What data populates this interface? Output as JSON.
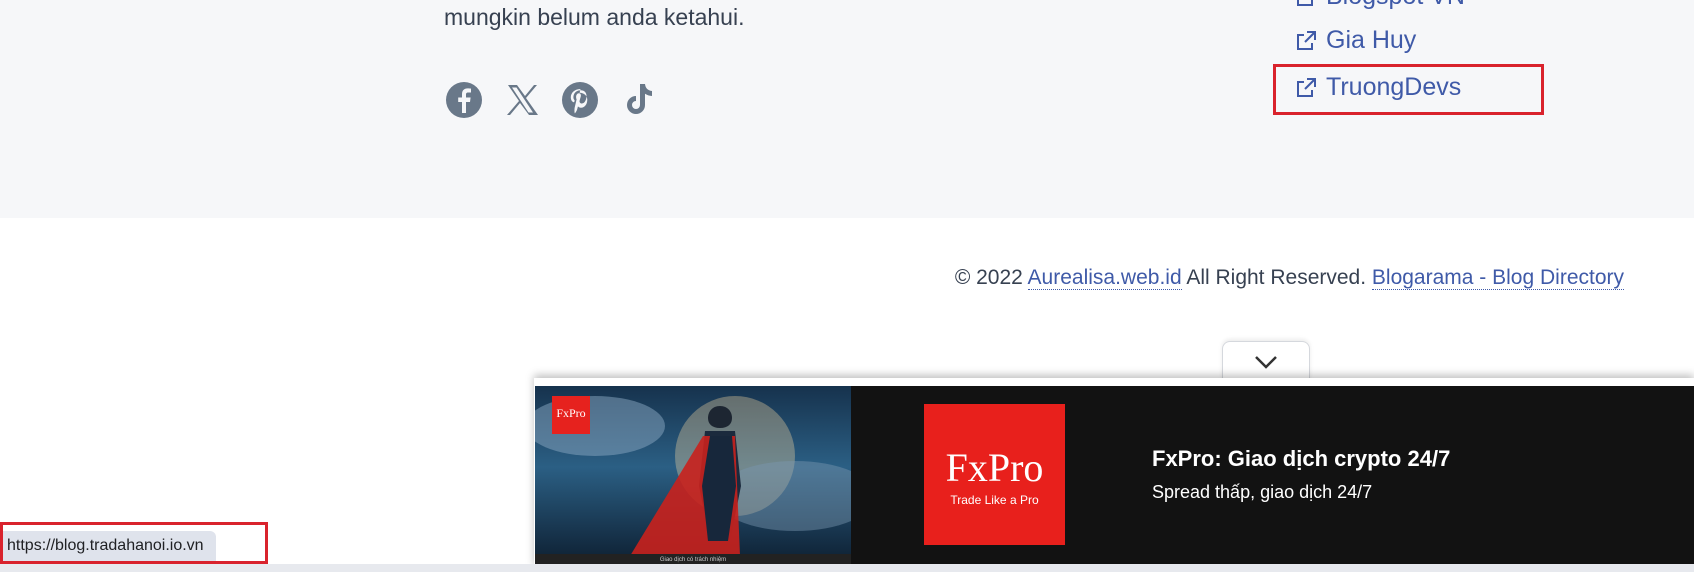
{
  "footer": {
    "about_text": "mungkin belum anda ketahui.",
    "social_icons": [
      "facebook-icon",
      "x-icon",
      "pinterest-icon",
      "tiktok-icon"
    ],
    "links": [
      {
        "label": "Blogspot VN",
        "icon": "external-link-icon"
      },
      {
        "label": "Gia Huy",
        "icon": "external-link-icon"
      },
      {
        "label": "TruongDevs",
        "icon": "external-link-icon",
        "highlighted": true
      }
    ],
    "copyright": {
      "prefix": "© 2022",
      "site_link": "Aurealisa.web.id",
      "middle": "All Right Reserved.",
      "directory_link": "Blogarama - Blog Directory"
    }
  },
  "ad": {
    "toggle_icon": "chevron-down-icon",
    "image_logo": "FxPro",
    "disclaimer": "Giao dịch có trách nhiệm",
    "logo_big": "FxPro",
    "logo_small": "Trade Like a Pro",
    "title": "FxPro: Giao dịch crypto 24/7",
    "description": "Spread thấp, giao dịch 24/7"
  },
  "status_bar": {
    "url": "https://blog.tradahanoi.io.vn",
    "highlighted": true
  },
  "colors": {
    "highlight": "#d9232d",
    "link": "#3f5aa8",
    "ad_brand": "#e8201c"
  }
}
